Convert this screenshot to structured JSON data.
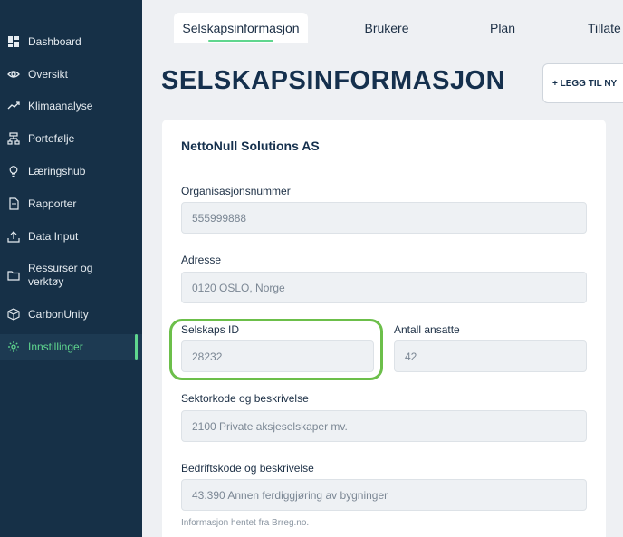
{
  "sidebar": {
    "items": [
      {
        "label": "Dashboard",
        "icon": "dashboard-icon"
      },
      {
        "label": "Oversikt",
        "icon": "eye-icon"
      },
      {
        "label": "Klimaanalyse",
        "icon": "trend-icon"
      },
      {
        "label": "Portefølje",
        "icon": "hierarchy-icon"
      },
      {
        "label": "Læringshub",
        "icon": "lightbulb-icon"
      },
      {
        "label": "Rapporter",
        "icon": "document-icon"
      },
      {
        "label": "Data Input",
        "icon": "upload-icon"
      },
      {
        "label": "Ressurser og verktøy",
        "icon": "folder-icon"
      },
      {
        "label": "CarbonUnity",
        "icon": "cube-icon"
      },
      {
        "label": "Innstillinger",
        "icon": "gear-icon"
      }
    ],
    "active_index": 9
  },
  "tabs": [
    {
      "label": "Selskapsinformasjon"
    },
    {
      "label": "Brukere"
    },
    {
      "label": "Plan"
    },
    {
      "label": "Tillate"
    }
  ],
  "page_title": "SELSKAPSINFORMASJON",
  "add_button_label": "+ LEGG TIL NY",
  "company": {
    "name": "NettoNull Solutions AS",
    "org_number_label": "Organisasjonsnummer",
    "org_number": "555999888",
    "address_label": "Adresse",
    "address": "0120 OSLO, Norge",
    "company_id_label": "Selskaps ID",
    "company_id": "28232",
    "employees_label": "Antall ansatte",
    "employees": "42",
    "sector_label": "Sektorkode og beskrivelse",
    "sector": "2100 Private aksjeselskaper mv.",
    "industry_label": "Bedriftskode og beskrivelse",
    "industry": "43.390 Annen ferdiggjøring av bygninger",
    "source_note": "Informasjon hentet fra Brreg.no."
  },
  "colors": {
    "sidebar_bg": "#163047",
    "accent": "#5fd68e",
    "highlight": "#6cbf4a",
    "title": "#15304d"
  }
}
